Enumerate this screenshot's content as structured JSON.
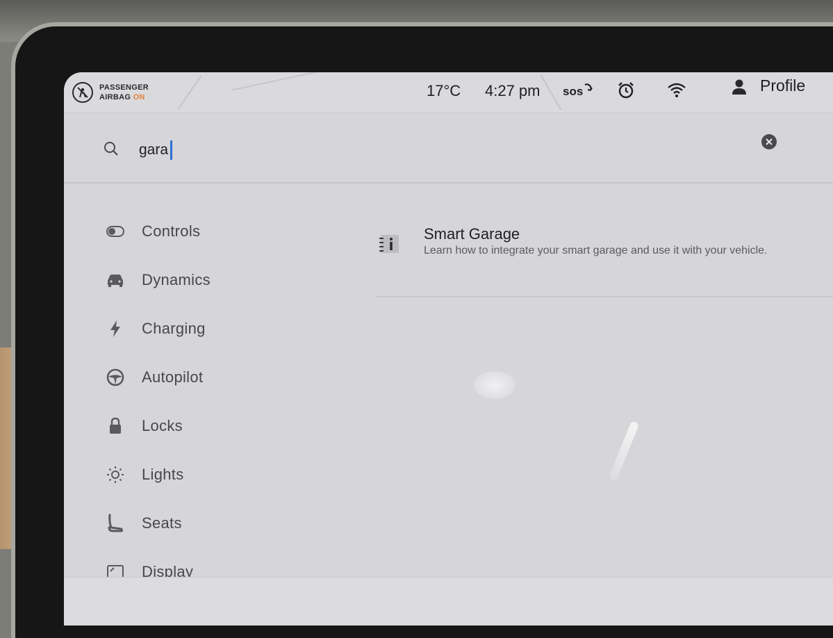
{
  "status_bar": {
    "airbag_line1": "PASSENGER",
    "airbag_line2": "AIRBAG",
    "airbag_state": "ON",
    "temperature": "17°C",
    "time": "4:27 pm",
    "sos_label": "sos",
    "profile_label": "Profile"
  },
  "search": {
    "value": "gara"
  },
  "nav": {
    "items": [
      {
        "label": "Controls",
        "icon": "toggle-icon"
      },
      {
        "label": "Dynamics",
        "icon": "car-icon"
      },
      {
        "label": "Charging",
        "icon": "bolt-icon"
      },
      {
        "label": "Autopilot",
        "icon": "steering-wheel-icon"
      },
      {
        "label": "Locks",
        "icon": "lock-icon"
      },
      {
        "label": "Lights",
        "icon": "light-icon"
      },
      {
        "label": "Seats",
        "icon": "seat-icon"
      },
      {
        "label": "Display",
        "icon": "display-icon"
      }
    ]
  },
  "results": [
    {
      "title": "Smart Garage",
      "subtitle": "Learn how to integrate your smart garage and use it with your vehicle.",
      "icon": "manual-info-icon"
    }
  ],
  "colors": {
    "airbag_on": "#e4823a",
    "caret": "#2f6fd6"
  }
}
